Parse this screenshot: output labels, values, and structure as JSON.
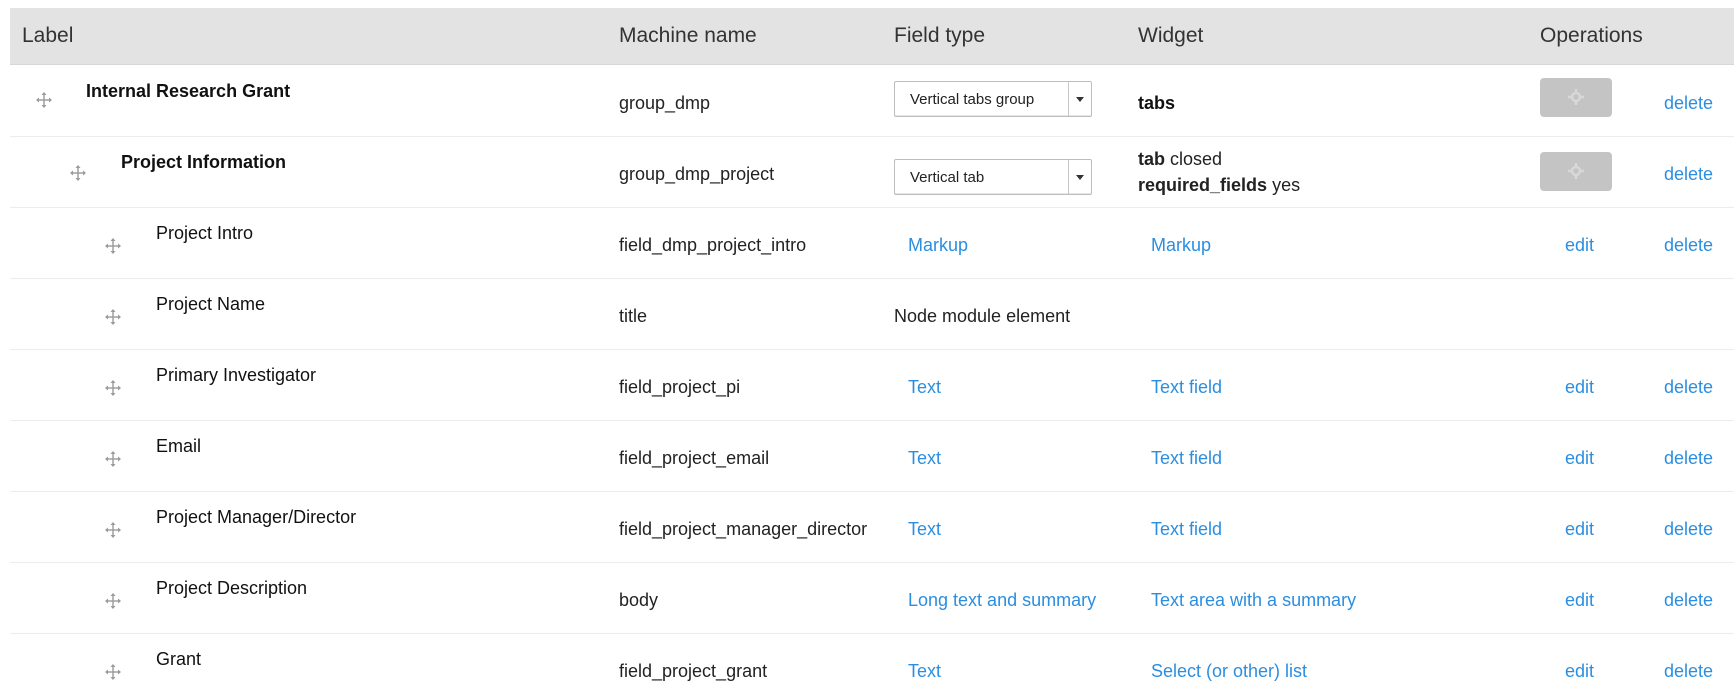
{
  "header": {
    "label": "Label",
    "machine_name": "Machine name",
    "field_type": "Field type",
    "widget": "Widget",
    "operations": "Operations"
  },
  "rows": [
    {
      "label": "Internal Research Grant",
      "machine": "group_dmp",
      "field_type_select": "Vertical tabs group",
      "widget_key1": "tabs",
      "delete": "delete"
    },
    {
      "label": "Project Information",
      "machine": "group_dmp_project",
      "field_type_select": "Vertical tab",
      "widget_key1": "tab",
      "widget_val1": "closed",
      "widget_key2": "required_fields",
      "widget_val2": "yes",
      "delete": "delete"
    },
    {
      "label": "Project Intro",
      "machine": "field_dmp_project_intro",
      "field_type": "Markup",
      "widget": "Markup",
      "edit": "edit",
      "delete": "delete"
    },
    {
      "label": "Project Name",
      "machine": "title",
      "field_type": "Node module element"
    },
    {
      "label": "Primary Investigator",
      "machine": "field_project_pi",
      "field_type": "Text",
      "widget": "Text field",
      "edit": "edit",
      "delete": "delete"
    },
    {
      "label": "Email",
      "machine": "field_project_email",
      "field_type": "Text",
      "widget": "Text field",
      "edit": "edit",
      "delete": "delete"
    },
    {
      "label": "Project Manager/Director",
      "machine": "field_project_manager_director",
      "field_type": "Text",
      "widget": "Text field",
      "edit": "edit",
      "delete": "delete"
    },
    {
      "label": "Project Description",
      "machine": "body",
      "field_type": "Long text and summary",
      "widget": "Text area with a summary",
      "edit": "edit",
      "delete": "delete"
    },
    {
      "label": "Grant",
      "machine": "field_project_grant",
      "field_type": "Text",
      "widget": "Select (or other) list",
      "edit": "edit",
      "delete": "delete"
    }
  ],
  "colors": {
    "link": "#2b8ee0",
    "header_bg": "#e3e3e3",
    "button_disabled": "#c4c4c4"
  },
  "icons": {
    "drag_handle": "drag-handle-icon",
    "gear": "gear-icon",
    "select_arrow": "chevron-down-icon"
  }
}
